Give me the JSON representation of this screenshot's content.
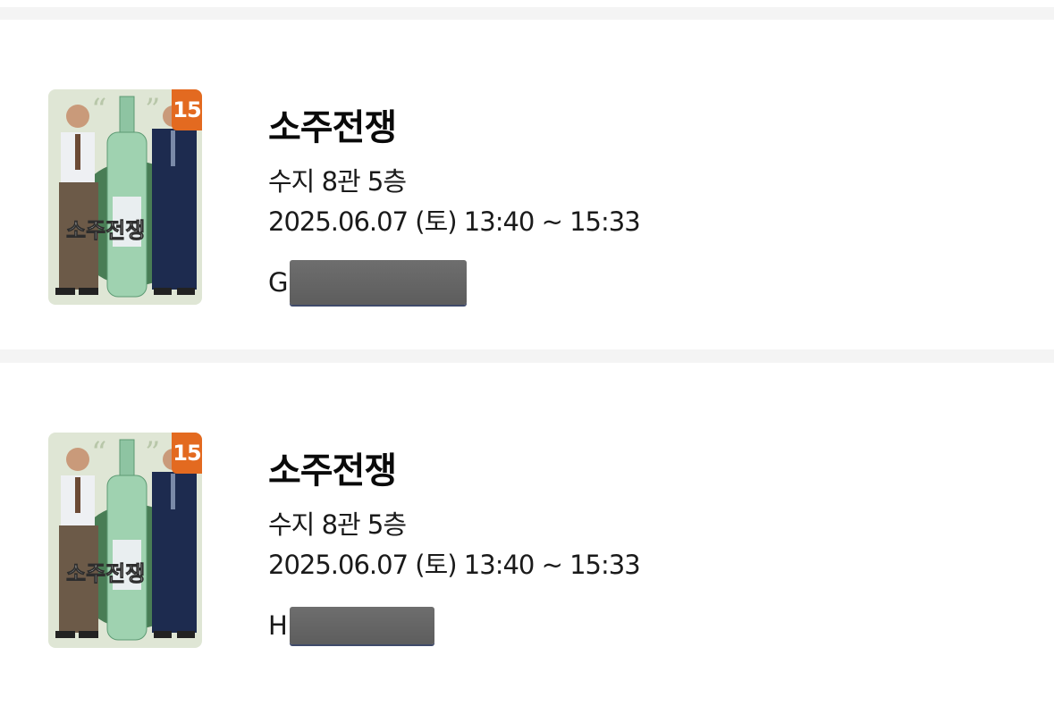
{
  "bookings": [
    {
      "rating_badge": "15",
      "poster_title": "소주전쟁",
      "title": "소주전쟁",
      "location": "수지 8관 5층",
      "datetime": "2025.06.07 (토) 13:40 ~ 15:33",
      "seat_visible": "G"
    },
    {
      "rating_badge": "15",
      "poster_title": "소주전쟁",
      "title": "소주전쟁",
      "location": "수지 8관 5층",
      "datetime": "2025.06.07 (토) 13:40 ~ 15:33",
      "seat_visible": "H"
    }
  ],
  "colors": {
    "rating_badge": "#e36a20",
    "divider": "#f4f4f4",
    "redaction": "#666666"
  }
}
